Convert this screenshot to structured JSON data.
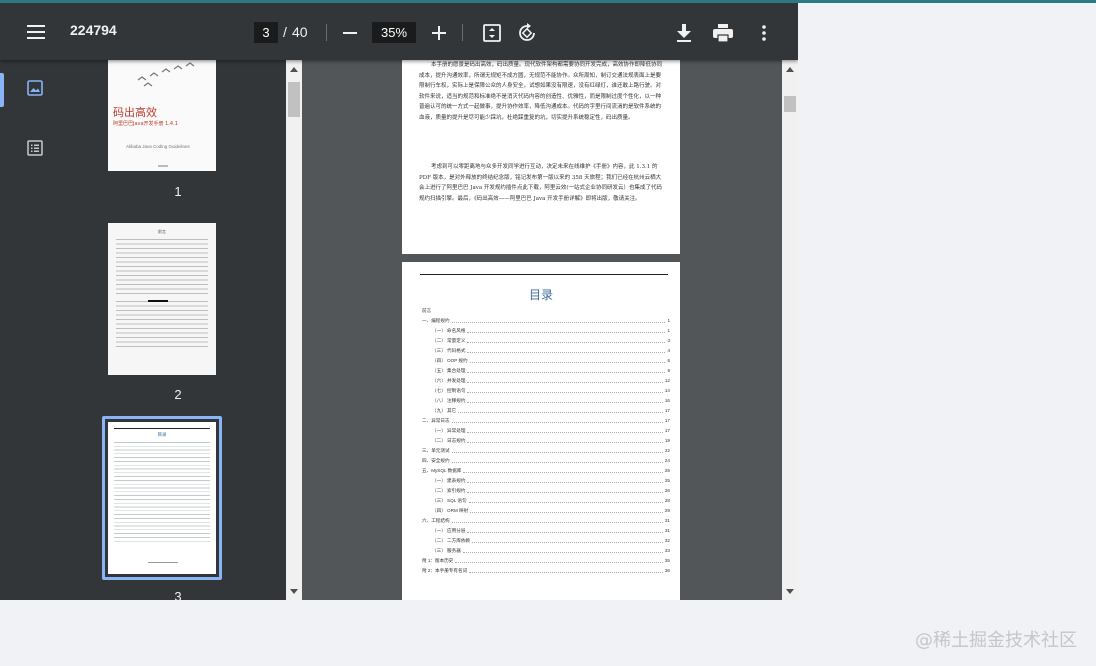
{
  "toolbar": {
    "menu_icon": "hamburger-menu-icon",
    "doc_title": "224794",
    "current_page": "3",
    "page_separator": "/",
    "total_pages": "40",
    "zoom_out_icon": "minus-icon",
    "zoom_value": "35%",
    "zoom_in_icon": "plus-icon",
    "fit_icon": "fit-to-page-icon",
    "rotate_icon": "rotate-icon",
    "download_icon": "download-icon",
    "print_icon": "print-icon",
    "more_icon": "more-vertical-icon"
  },
  "sidebar": {
    "thumbnails_icon": "image-icon",
    "outline_icon": "list-icon"
  },
  "thumbnails": [
    {
      "label": "1",
      "cover_title": "码出高效",
      "cover_subtitle": "阿里巴巴Java开发手册 1.4.1",
      "cover_english": "Alibaba Java Coding Guidelines"
    },
    {
      "label": "2",
      "heading": "前言"
    },
    {
      "label": "3",
      "heading": "目录"
    }
  ],
  "page2_text": {
    "para1": "本手册的愿景是码出高效，码出质量。现代软件架构都需要协同开发完成，高效协作即降低协同成本，提升沟通效率，所谓无规矩不成方圆，无规范不能协作。众所周知，制订交通法规表面上是要限制行车权，实际上是保障公众的人身安全，试想如果没有限速，没有红绿灯，谁还敢上路行驶。对软件来说，适当的规范和标准绝不是消灭代码内容的创造性、优雅性，而是限制过度个性化，以一种普遍认可的统一方式一起做事，提升协作效率，降低沟通成本。代码的字里行间流淌的是软件系统的血液，质量的提升是尽可能少踩坑，杜绝踩重复的坑，切实提升系统稳定性，码出质量。",
    "para2": "考虑到可以零距离地与众多开发同学进行互动，决定未来在线维护《手册》内容，此 1.3.1 的 PDF 版本，是对外释放的终结纪念版，铭记发布第一版以来的 358 天旅程；我们已经在杭州云栖大会上进行了阿里巴巴 Java 开发规约插件点此下载，阿里云效(一站式企业协同研发云）也集成了代码规约扫描引擎。最后，《码出高效——阿里巴巴 Java 开发手册详解》即将出版，敬请关注。"
  },
  "toc": {
    "title": "目录",
    "entries": [
      {
        "label": "前言",
        "page": "",
        "indent": 0
      },
      {
        "label": "一、编程规约",
        "page": "1",
        "indent": 0
      },
      {
        "label": "（一） 命名风格",
        "page": "1",
        "indent": 1
      },
      {
        "label": "（二） 常量定义",
        "page": "3",
        "indent": 1
      },
      {
        "label": "（三） 代码格式",
        "page": "4",
        "indent": 1
      },
      {
        "label": "（四） OOP 规约",
        "page": "6",
        "indent": 1
      },
      {
        "label": "（五） 集合处理",
        "page": "9",
        "indent": 1
      },
      {
        "label": "（六） 并发处理",
        "page": "12",
        "indent": 1
      },
      {
        "label": "（七） 控制语句",
        "page": "14",
        "indent": 1
      },
      {
        "label": "（八） 注释规约",
        "page": "16",
        "indent": 1
      },
      {
        "label": "（九） 其它",
        "page": "17",
        "indent": 1
      },
      {
        "label": "二、异常日志",
        "page": "17",
        "indent": 0
      },
      {
        "label": "（一） 异常处理",
        "page": "17",
        "indent": 1
      },
      {
        "label": "（二） 日志规约",
        "page": "19",
        "indent": 1
      },
      {
        "label": "三、单元测试",
        "page": "22",
        "indent": 0
      },
      {
        "label": "四、安全规约",
        "page": "24",
        "indent": 0
      },
      {
        "label": "五、MySQL 数据库",
        "page": "25",
        "indent": 0
      },
      {
        "label": "（一） 建表规约",
        "page": "25",
        "indent": 1
      },
      {
        "label": "（二） 索引规约",
        "page": "26",
        "indent": 1
      },
      {
        "label": "（三） SQL 语句",
        "page": "28",
        "indent": 1
      },
      {
        "label": "（四） ORM 映射",
        "page": "29",
        "indent": 1
      },
      {
        "label": "六、工程结构",
        "page": "31",
        "indent": 0
      },
      {
        "label": "（一） 应用分层",
        "page": "31",
        "indent": 1
      },
      {
        "label": "（二） 二方库依赖",
        "page": "32",
        "indent": 1
      },
      {
        "label": "（三） 服务器",
        "page": "33",
        "indent": 1
      },
      {
        "label": "附 1：版本历史",
        "page": "35",
        "indent": 0
      },
      {
        "label": "附 2：本手册专有名词",
        "page": "36",
        "indent": 0
      }
    ]
  },
  "watermark": "@稀土掘金技术社区",
  "colors": {
    "toolbar": "#323639",
    "canvas": "#525659",
    "accent": "#8ab4f8",
    "toc_title": "#3c6c9a"
  }
}
